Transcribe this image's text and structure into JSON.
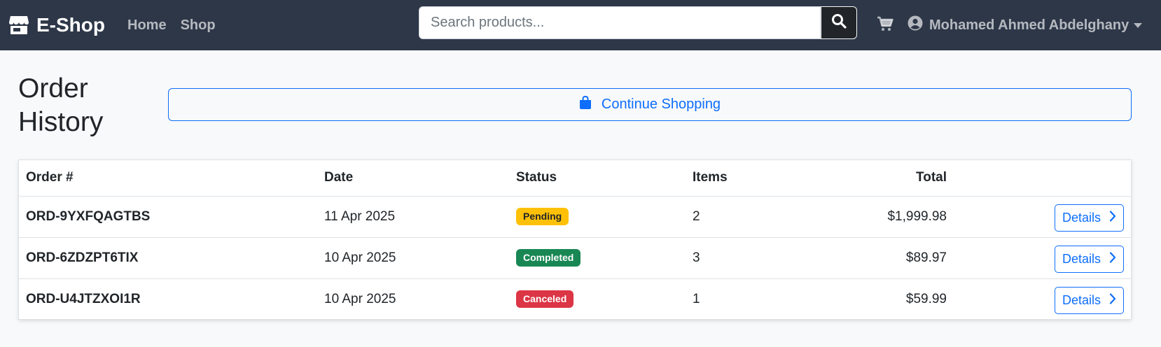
{
  "navbar": {
    "brand": "E-Shop",
    "links": [
      {
        "label": "Home"
      },
      {
        "label": "Shop"
      }
    ],
    "search": {
      "placeholder": "Search products...",
      "value": ""
    },
    "user_name": "Mohamed Ahmed Abdelghany",
    "colors": {
      "background": "#2d3748"
    }
  },
  "page": {
    "title": "Order History",
    "continue_label": "Continue Shopping"
  },
  "orders_table": {
    "columns": [
      "Order #",
      "Date",
      "Status",
      "Items",
      "Total"
    ],
    "rows": [
      {
        "order_no": "ORD-9YXFQAGTBS",
        "date": "11 Apr 2025",
        "status": "Pending",
        "status_color": "#ffc107",
        "items": "2",
        "total": "$1,999.98",
        "action": "Details"
      },
      {
        "order_no": "ORD-6ZDZPT6TIX",
        "date": "10 Apr 2025",
        "status": "Completed",
        "status_color": "#198754",
        "items": "3",
        "total": "$89.97",
        "action": "Details"
      },
      {
        "order_no": "ORD-U4JTZXOI1R",
        "date": "10 Apr 2025",
        "status": "Canceled",
        "status_color": "#dc3545",
        "items": "1",
        "total": "$59.99",
        "action": "Details"
      }
    ]
  }
}
